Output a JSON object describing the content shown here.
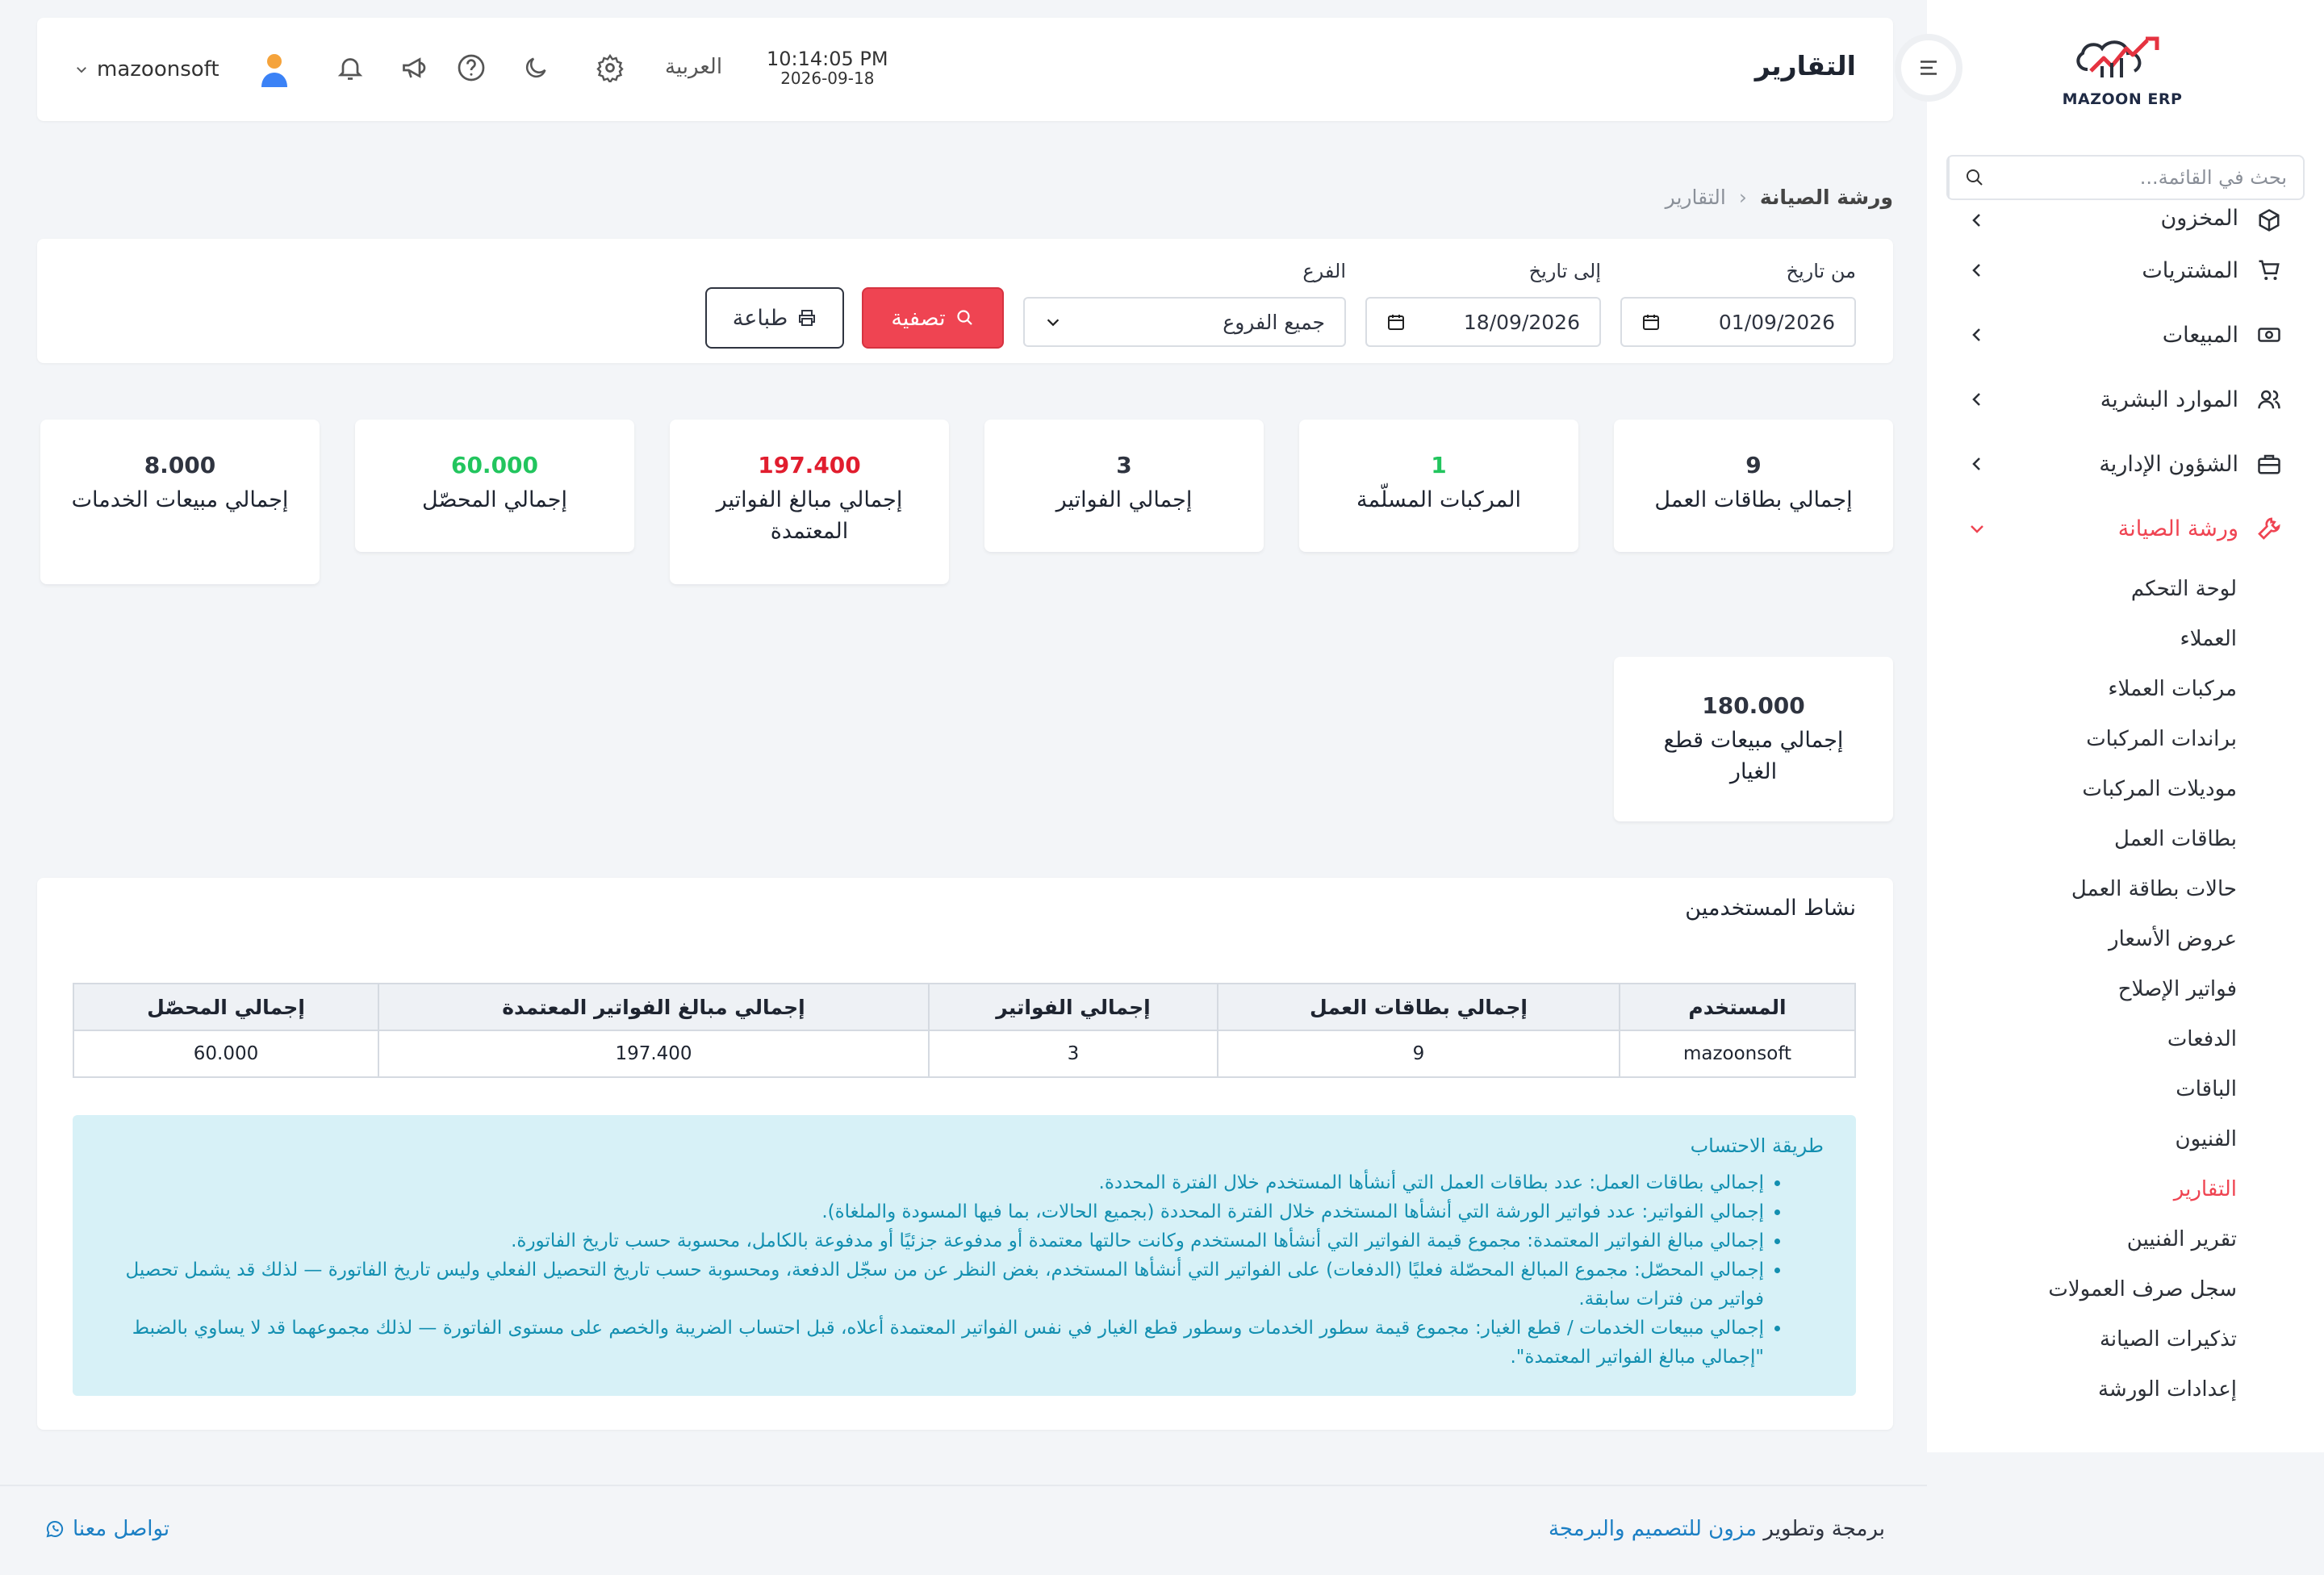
{
  "sidebar": {
    "logo_text": "MAZOON ERP",
    "search_placeholder": "بحث في القائمة...",
    "items": [
      {
        "label": "المخزون",
        "icon": "box-icon"
      },
      {
        "label": "المشتريات",
        "icon": "cart-icon"
      },
      {
        "label": "المبيعات",
        "icon": "cash-icon"
      },
      {
        "label": "الموارد البشرية",
        "icon": "users-icon"
      },
      {
        "label": "الشؤون الإدارية",
        "icon": "briefcase-icon"
      },
      {
        "label": "ورشة الصيانة",
        "icon": "wrench-icon"
      }
    ],
    "sub_items": [
      "لوحة التحكم",
      "العملاء",
      "مركبات العملاء",
      "براندات المركبات",
      "موديلات المركبات",
      "بطاقات العمل",
      "حالات بطاقة العمل",
      "عروض الأسعار",
      "فواتير الإصلاح",
      "الدفعات",
      "الباقات",
      "الفنيون",
      "التقارير",
      "تقرير الفنيين",
      "سجل صرف العمولات",
      "تذكيرات الصيانة",
      "إعدادات الورشة"
    ]
  },
  "header": {
    "title": "التقارير",
    "time": "10:14:05 PM",
    "date": "2026-09-18",
    "language": "العربية",
    "username": "mazoonsoft"
  },
  "breadcrumb": {
    "section": "ورشة الصيانة",
    "current": "التقارير"
  },
  "filters": {
    "from_label": "من تاريخ",
    "from_value": "01/09/2026",
    "to_label": "إلى تاريخ",
    "to_value": "18/09/2026",
    "branch_label": "الفرع",
    "branch_value": "جميع الفروع",
    "filter_button": "تصفية",
    "print_button": "طباعة"
  },
  "stats": [
    {
      "value": "9",
      "label": "إجمالي بطاقات العمل",
      "color": "#2f3440"
    },
    {
      "value": "1",
      "label": "المركبات المسلّمة",
      "color": "#22c55e"
    },
    {
      "value": "3",
      "label": "إجمالي الفواتير",
      "color": "#2f3440"
    },
    {
      "value": "197.400",
      "label": "إجمالي مبالغ الفواتير المعتمدة",
      "color": "#e11d2e"
    },
    {
      "value": "60.000",
      "label": "إجمالي المحصّل",
      "color": "#22c55e"
    },
    {
      "value": "8.000",
      "label": "إجمالي مبيعات الخدمات",
      "color": "#2f3440"
    },
    {
      "value": "180.000",
      "label": "إجمالي مبيعات قطع الغيار",
      "color": "#2f3440"
    }
  ],
  "activity": {
    "title": "نشاط المستخدمين",
    "columns": [
      "المستخدم",
      "إجمالي بطاقات العمل",
      "إجمالي الفواتير",
      "إجمالي مبالغ الفواتير المعتمدة",
      "إجمالي المحصّل"
    ],
    "rows": [
      [
        "mazoonsoft",
        "9",
        "3",
        "197.400",
        "60.000"
      ]
    ],
    "method_title": "طريقة الاحتساب",
    "method_items": [
      "إجمالي بطاقات العمل: عدد بطاقات العمل التي أنشأها المستخدم خلال الفترة المحددة.",
      "إجمالي الفواتير: عدد فواتير الورشة التي أنشأها المستخدم خلال الفترة المحددة (بجميع الحالات، بما فيها المسودة والملغاة).",
      "إجمالي مبالغ الفواتير المعتمدة: مجموع قيمة الفواتير التي أنشأها المستخدم وكانت حالتها معتمدة أو مدفوعة جزئيًا أو مدفوعة بالكامل، محسوبة حسب تاريخ الفاتورة.",
      "إجمالي المحصّل: مجموع المبالغ المحصّلة فعليًا (الدفعات) على الفواتير التي أنشأها المستخدم، بغض النظر عن من سجّل الدفعة، ومحسوبة حسب تاريخ التحصيل الفعلي وليس تاريخ الفاتورة — لذلك قد يشمل تحصيل فواتير من فترات سابقة.",
      "إجمالي مبيعات الخدمات / قطع الغيار: مجموع قيمة سطور الخدمات وسطور قطع الغيار في نفس الفواتير المعتمدة أعلاه، قبل احتساب الضريبة والخصم على مستوى الفاتورة — لذلك مجموعهما قد لا يساوي بالضبط \"إجمالي مبالغ الفواتير المعتمدة\"."
    ]
  },
  "footer": {
    "prefix": "برمجة وتطوير",
    "brand": "مزون للتصميم والبرمجة",
    "contact": "تواصل معنا"
  }
}
